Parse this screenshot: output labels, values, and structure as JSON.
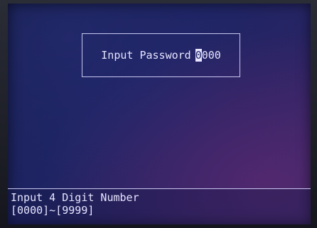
{
  "dialog": {
    "label": "Input Password",
    "digits": [
      "0",
      "0",
      "0",
      "0"
    ],
    "cursor_index": 0
  },
  "status": {
    "line1": "Input 4 Digit Number",
    "line2": "[0000]~[9999]"
  }
}
